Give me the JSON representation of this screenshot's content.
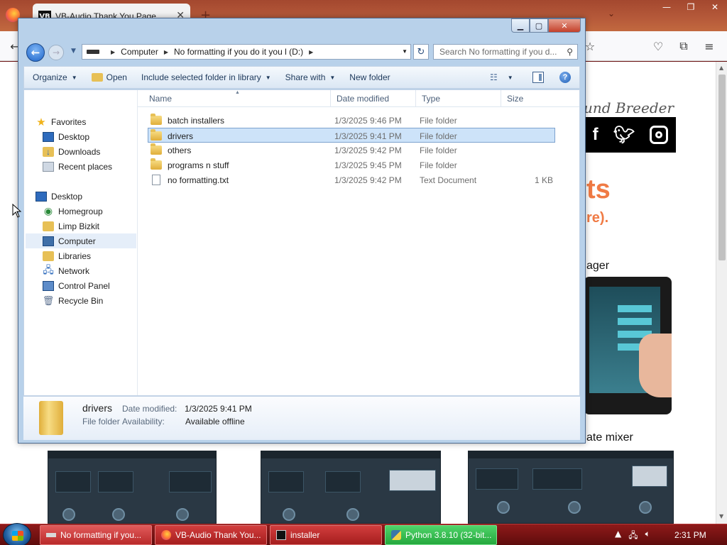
{
  "browser": {
    "tab_title": "VB-Audio Thank You Page",
    "tab_favicon_text": "VB",
    "page": {
      "brand_text": "und Breeder",
      "social": [
        "f",
        "twitter-icon",
        "instagram-icon"
      ],
      "heading_fragment": "ts",
      "subheading_fragment": "re).",
      "manager_text": "ager",
      "mixer_text": "ate mixer"
    }
  },
  "explorer": {
    "path": {
      "root": "Computer",
      "drive": "No formatting if you do it you l (D:)"
    },
    "search_placeholder": "Search No formatting if you d...",
    "commands": {
      "organize": "Organize",
      "open": "Open",
      "include": "Include selected folder in library",
      "share": "Share with",
      "new_folder": "New folder"
    },
    "nav": {
      "favorites": "Favorites",
      "desktop": "Desktop",
      "downloads": "Downloads",
      "recent": "Recent places",
      "desktop_root": "Desktop",
      "homegroup": "Homegroup",
      "user": "Limp Bizkit",
      "computer": "Computer",
      "libraries": "Libraries",
      "network": "Network",
      "control_panel": "Control Panel",
      "recycle_bin": "Recycle Bin"
    },
    "columns": {
      "name": "Name",
      "date": "Date modified",
      "type": "Type",
      "size": "Size"
    },
    "files": [
      {
        "name": "batch installers",
        "date": "1/3/2025 9:46 PM",
        "type": "File folder",
        "size": ""
      },
      {
        "name": "drivers",
        "date": "1/3/2025 9:41 PM",
        "type": "File folder",
        "size": ""
      },
      {
        "name": "others",
        "date": "1/3/2025 9:42 PM",
        "type": "File folder",
        "size": ""
      },
      {
        "name": "programs n stuff",
        "date": "1/3/2025 9:45 PM",
        "type": "File folder",
        "size": ""
      },
      {
        "name": "no formatting.txt",
        "date": "1/3/2025 9:42 PM",
        "type": "Text Document",
        "size": "1 KB"
      }
    ],
    "details": {
      "name": "drivers",
      "date_label": "Date modified:",
      "date_value": "1/3/2025 9:41 PM",
      "type": "File folder",
      "availability_label": "Availability:",
      "availability_value": "Available offline"
    }
  },
  "taskbar": {
    "items": [
      {
        "label": "No formatting if you..."
      },
      {
        "label": "VB-Audio Thank You..."
      },
      {
        "label": "installer"
      },
      {
        "label": "Python 3.8.10 (32-bit..."
      }
    ],
    "clock": "2:31 PM"
  }
}
